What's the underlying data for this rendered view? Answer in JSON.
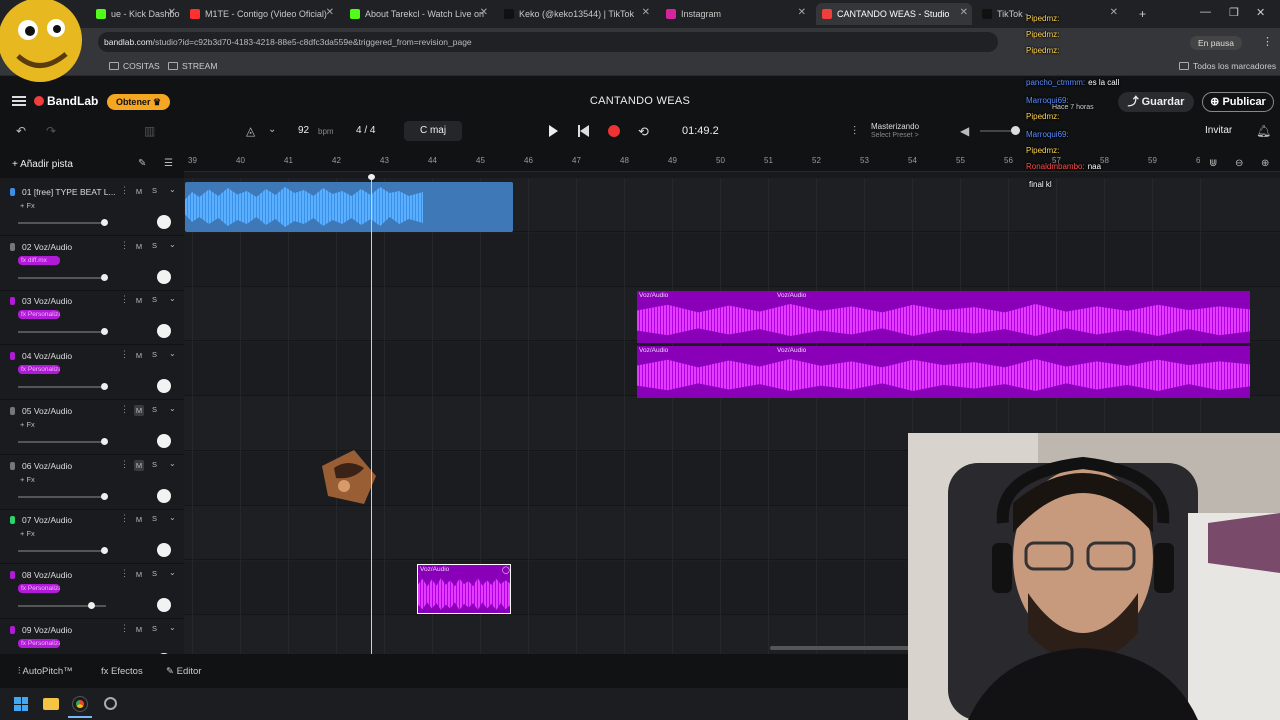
{
  "browser": {
    "tabs": [
      {
        "label": "ue - Kick Dashbo",
        "color": "#53fc18"
      },
      {
        "label": "M1TE - Contigo (Video Oficial)",
        "color": "#ff3030"
      },
      {
        "label": "About Tarekcl - Watch Live on",
        "color": "#53fc18"
      },
      {
        "label": "Keko (@keko13544) | TikTok",
        "color": "#111111"
      },
      {
        "label": "Instagram",
        "color": "#d6249f"
      },
      {
        "label": "CANTANDO WEAS - Studio",
        "color": "#f23d3d"
      },
      {
        "label": "TikTok -",
        "color": "#111111"
      }
    ],
    "url_host": "bandlab.com",
    "url_path": "/studio?id=c92b3d70-4183-4218-88e5-c8dfc3da559e&triggered_from=revision_page",
    "paused_label": "En pausa",
    "bookmarks": [
      "COSITAS",
      "STREAM"
    ],
    "all_bookmarks": "Todos los marcadores"
  },
  "studio": {
    "logo": "BandLab",
    "obtener": "Obtener",
    "project_title": "CANTANDO WEAS",
    "guardar": "Guardar",
    "publicar": "Publicar",
    "tempo": "92",
    "tempo_unit": "bpm",
    "time_signature": "4 / 4",
    "key": "C maj",
    "time": "01:49.2",
    "mastering": "Masterizando",
    "mastering_sub": "Select Preset >",
    "invitar": "Invitar",
    "add_track": "Añadir pista",
    "ruler": [
      "39",
      "40",
      "41",
      "42",
      "43",
      "44",
      "45",
      "46",
      "47",
      "48",
      "49",
      "50",
      "51",
      "52",
      "53",
      "54",
      "55",
      "56",
      "57",
      "58",
      "59",
      "6"
    ],
    "tracks": [
      {
        "name": "01  [free] TYPE BEAT L...",
        "fx": "+ Fx",
        "chip": false,
        "mute_on": false,
        "vol": 0.98
      },
      {
        "name": "02  Voz/Audio",
        "fx": "fx diff.mx",
        "chip": true,
        "mute_on": false,
        "vol": 0.98
      },
      {
        "name": "03  Voz/Audio",
        "fx": "fx Personalizado",
        "chip": true,
        "mute_on": false,
        "vol": 0.98
      },
      {
        "name": "04  Voz/Audio",
        "fx": "fx Personalizado",
        "chip": true,
        "mute_on": false,
        "vol": 0.98
      },
      {
        "name": "05  Voz/Audio",
        "fx": "+ Fx",
        "chip": false,
        "mute_on": true,
        "vol": 0.98
      },
      {
        "name": "06  Voz/Audio",
        "fx": "+ Fx",
        "chip": false,
        "mute_on": true,
        "vol": 0.98
      },
      {
        "name": "07  Voz/Audio",
        "fx": "+ Fx",
        "chip": false,
        "mute_on": false,
        "vol": 0.98
      },
      {
        "name": "08  Voz/Audio",
        "fx": "fx Personalizado",
        "chip": true,
        "mute_on": false,
        "vol": 0.83
      },
      {
        "name": "09  Voz/Audio",
        "fx": "fx Personalizado",
        "chip": true,
        "mute_on": false,
        "vol": 0.98
      }
    ],
    "clip_label": "Voz/Audio",
    "bottom": {
      "autopitch": "AutoPitch™",
      "efectos": "Efectos",
      "editor": "Editor"
    }
  },
  "chat": [
    {
      "user": "Pipedmz:",
      "text": "",
      "color": "#ffd54f"
    },
    {
      "user": "Pipedmz:",
      "text": "",
      "color": "#ffd54f"
    },
    {
      "user": "Pipedmz:",
      "text": "",
      "color": "#ffd54f"
    },
    {
      "user": "pancho_ctmmm:",
      "text": "es la call",
      "color": "#5b8cff"
    },
    {
      "user": "Marroqui69:",
      "text": "",
      "color": "#5b8cff"
    },
    {
      "user": "Pipedmz:",
      "text": "",
      "color": "#ffd54f"
    },
    {
      "user": "Marroqui69:",
      "text": "",
      "color": "#5b8cff"
    },
    {
      "user": "Pipedmz:",
      "text": "",
      "color": "#ffd54f"
    },
    {
      "user": "Ronaldmbambo:",
      "text": "naa",
      "color": "#ff4d4d"
    },
    {
      "user": "",
      "text": "final kl",
      "color": "#ff4d4d"
    }
  ],
  "chat_time": "Hace 7 horas"
}
